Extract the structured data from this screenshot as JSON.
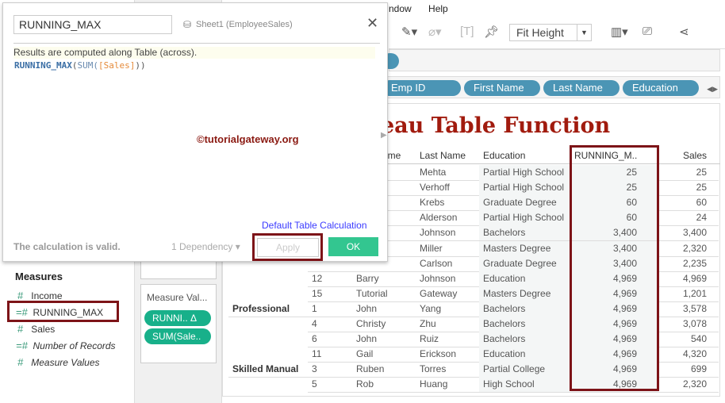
{
  "menu": [
    "ndow",
    "Help"
  ],
  "toolbar": {
    "fit": "Fit Height"
  },
  "columns_shelf": [
    "Emp ID",
    "First Name",
    "Last Name",
    "Education"
  ],
  "view_title": "eau Table Function",
  "table": {
    "headers": [
      "ame",
      "Last Name",
      "Education",
      "RUNNING_M..",
      "Sales"
    ],
    "rows": [
      {
        "occ": "",
        "id": "",
        "first": "",
        "last": "Mehta",
        "edu": "Partial High School",
        "rm": "25",
        "sales": "25"
      },
      {
        "occ": "",
        "id": "",
        "first": "",
        "last": "Verhoff",
        "edu": "Partial High School",
        "rm": "25",
        "sales": "25"
      },
      {
        "occ": "",
        "id": "",
        "first": "",
        "last": "Krebs",
        "edu": "Graduate Degree",
        "rm": "60",
        "sales": "60"
      },
      {
        "occ": "",
        "id": "",
        "first": "",
        "last": "Alderson",
        "edu": "Partial High School",
        "rm": "60",
        "sales": "24"
      },
      {
        "occ": "",
        "id": "",
        "first": "",
        "last": "Johnson",
        "edu": "Bachelors",
        "rm": "3,400",
        "sales": "3,400"
      },
      {
        "occ": "",
        "id": "",
        "first": "",
        "last": "Miller",
        "edu": "Masters Degree",
        "rm": "3,400",
        "sales": "2,320"
      },
      {
        "occ": "",
        "id": "",
        "first": "",
        "last": "Carlson",
        "edu": "Graduate Degree",
        "rm": "3,400",
        "sales": "2,235"
      },
      {
        "occ": "",
        "id": "12",
        "first": "Barry",
        "last": "Johnson",
        "edu": "Education",
        "rm": "4,969",
        "sales": "4,969"
      },
      {
        "occ": "",
        "id": "15",
        "first": "Tutorial",
        "last": "Gateway",
        "edu": "Masters Degree",
        "rm": "4,969",
        "sales": "1,201"
      },
      {
        "occ": "Professional",
        "id": "1",
        "first": "John",
        "last": "Yang",
        "edu": "Bachelors",
        "rm": "4,969",
        "sales": "3,578"
      },
      {
        "occ": "",
        "id": "4",
        "first": "Christy",
        "last": "Zhu",
        "edu": "Bachelors",
        "rm": "4,969",
        "sales": "3,078"
      },
      {
        "occ": "",
        "id": "6",
        "first": "John",
        "last": "Ruiz",
        "edu": "Bachelors",
        "rm": "4,969",
        "sales": "540"
      },
      {
        "occ": "",
        "id": "11",
        "first": "Gail",
        "last": "Erickson",
        "edu": "Education",
        "rm": "4,969",
        "sales": "4,320"
      },
      {
        "occ": "Skilled Manual",
        "id": "3",
        "first": "Ruben",
        "last": "Torres",
        "edu": "Partial College",
        "rm": "4,969",
        "sales": "699"
      },
      {
        "occ": "",
        "id": "5",
        "first": "Rob",
        "last": "Huang",
        "edu": "High School",
        "rm": "4,969",
        "sales": "2,320"
      }
    ]
  },
  "sidebar": {
    "heading": "Measures",
    "items": [
      "Income",
      "RUNNING_MAX",
      "Sales",
      "Number of Records",
      "Measure Values"
    ]
  },
  "card": {
    "title": "Measure Val...",
    "pills": [
      "RUNNI..  Δ",
      "SUM(Sale.."
    ]
  },
  "dialog": {
    "name": "RUNNING_MAX",
    "source": "Sheet1 (EmployeeSales)",
    "info": "Results are computed along Table (across).",
    "formula_fn": "RUNNING_MAX",
    "formula_open": "(",
    "formula_sum": "SUM(",
    "formula_field": "[Sales]",
    "formula_close": "))",
    "watermark": "©tutorialgateway.org",
    "default_link": "Default Table Calculation",
    "status": "The calculation is valid.",
    "dependency": "1 Dependency ▾",
    "apply": "Apply",
    "ok": "OK"
  }
}
